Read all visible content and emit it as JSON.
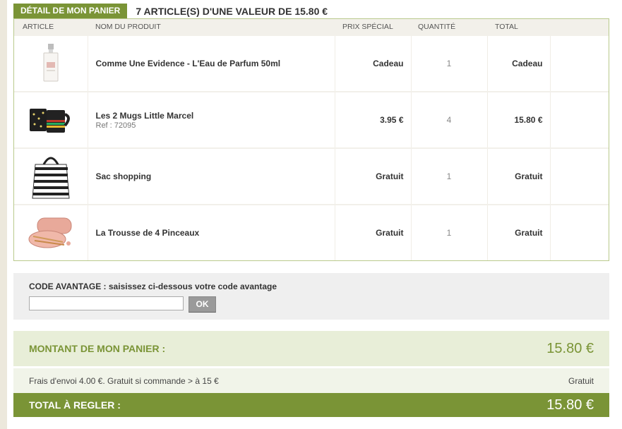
{
  "header": {
    "tab_label": "DÉTAIL DE MON PANIER",
    "summary": "7 ARTICLE(S) D'UNE VALEUR DE 15.80 €"
  },
  "table": {
    "columns": [
      "ARTICLE",
      "NOM DU PRODUIT",
      "PRIX SPÉCIAL",
      "QUANTITÉ",
      "TOTAL"
    ],
    "rows": [
      {
        "image": "perfume-bottle-image",
        "name": "Comme Une Evidence - L'Eau de Parfum 50ml",
        "ref": "",
        "price": "Cadeau",
        "qty": "1",
        "total": "Cadeau"
      },
      {
        "image": "mugs-image",
        "name": "Les 2 Mugs Little Marcel",
        "ref": "Ref : 72095",
        "price": "3.95 €",
        "qty": "4",
        "total": "15.80 €"
      },
      {
        "image": "shopping-bag-image",
        "name": "Sac shopping",
        "ref": "",
        "price": "Gratuit",
        "qty": "1",
        "total": "Gratuit"
      },
      {
        "image": "brush-case-image",
        "name": "La Trousse de 4 Pinceaux",
        "ref": "",
        "price": "Gratuit",
        "qty": "1",
        "total": "Gratuit"
      }
    ]
  },
  "promo": {
    "label": "CODE AVANTAGE : saisissez ci-dessous votre code avantage",
    "input_value": "",
    "button_label": "OK"
  },
  "totals": {
    "amount_label": "MONTANT DE MON PANIER :",
    "amount_value": "15.80 €",
    "shipping_label": "Frais d'envoi 4.00 €. Gratuit si commande > à 15 €",
    "shipping_value": "Gratuit",
    "grand_label": "TOTAL À REGLER :",
    "grand_value": "15.80 €"
  },
  "colors": {
    "accent_green": "#7a9436",
    "light_green": "#e8eed8"
  }
}
